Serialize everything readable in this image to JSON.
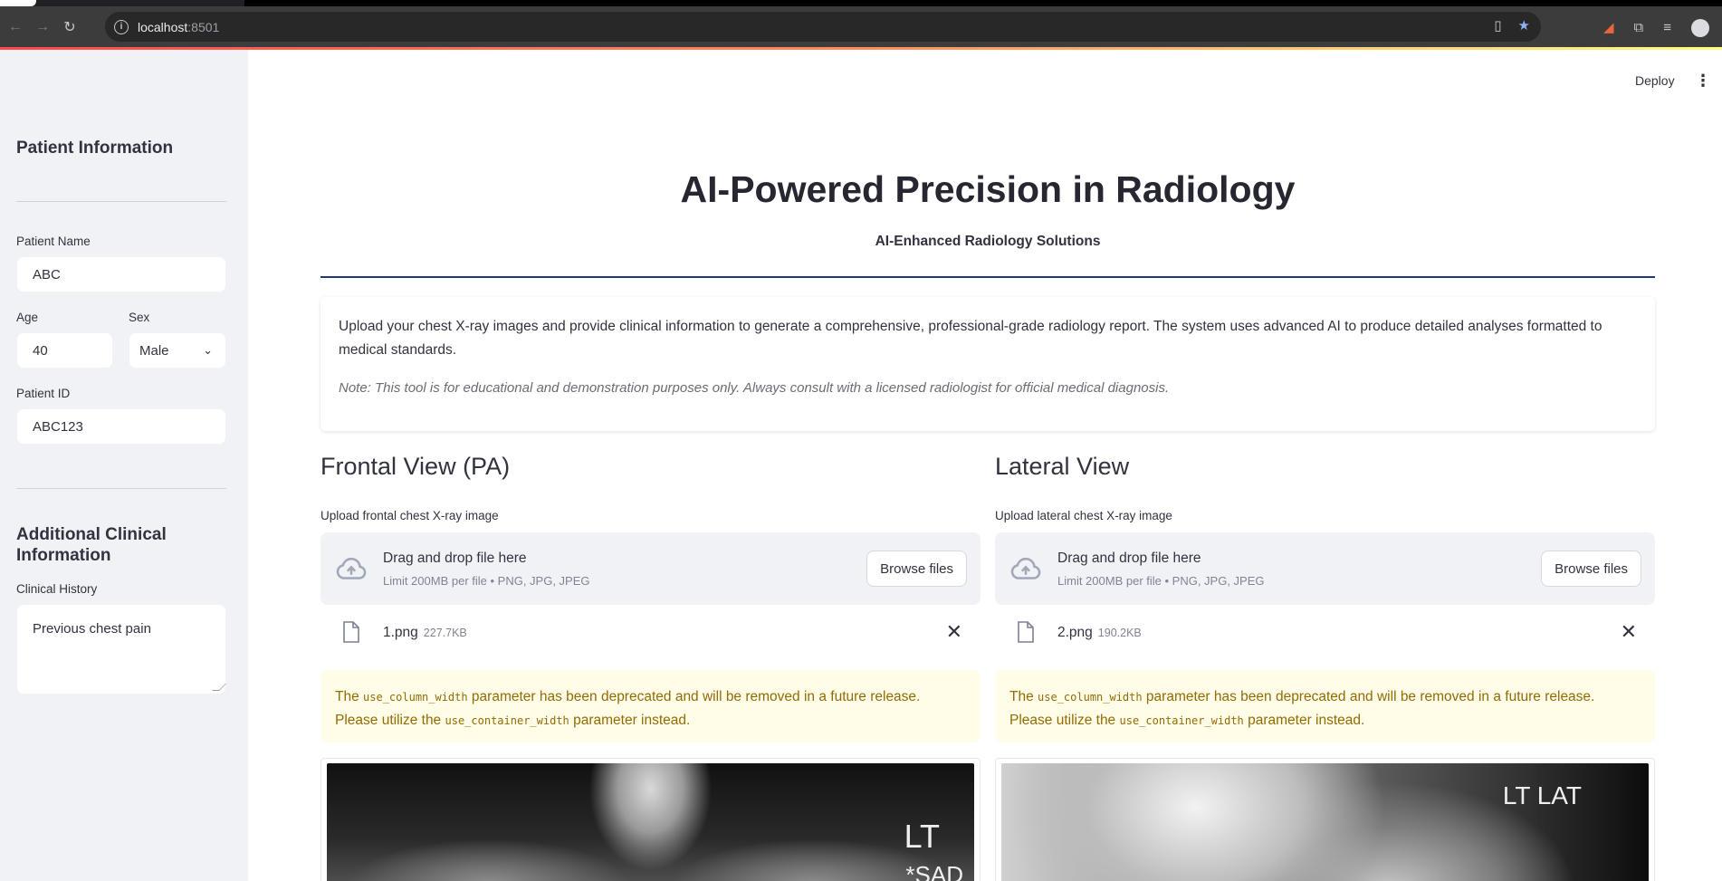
{
  "browser": {
    "url_host": "localhost",
    "url_port": ":8501"
  },
  "header": {
    "deploy_label": "Deploy"
  },
  "sidebar": {
    "patient_info_heading": "Patient Information",
    "patient_name_label": "Patient Name",
    "patient_name_value": "ABC",
    "age_label": "Age",
    "age_value": "40",
    "sex_label": "Sex",
    "sex_value": "Male",
    "patient_id_label": "Patient ID",
    "patient_id_value": "ABC123",
    "clinical_heading": "Additional Clinical Information",
    "clinical_history_label": "Clinical History",
    "clinical_history_value": "Previous chest pain"
  },
  "main": {
    "title": "AI-Powered Precision in Radiology",
    "subtitle": "AI-Enhanced Radiology Solutions",
    "intro": "Upload your chest X-ray images and provide clinical information to generate a comprehensive, professional-grade radiology report. The system uses advanced AI to produce detailed analyses formatted to medical standards.",
    "note": "Note: This tool is for educational and demonstration purposes only. Always consult with a licensed radiologist for official medical diagnosis."
  },
  "columns": [
    {
      "heading": "Frontal View (PA)",
      "upload_label": "Upload frontal chest X-ray image",
      "drop_title": "Drag and drop file here",
      "drop_limit": "Limit 200MB per file • PNG, JPG, JPEG",
      "browse_label": "Browse files",
      "file_name": "1.png",
      "file_size": "227.7KB",
      "warn_pre": "The ",
      "warn_code1": "use_column_width",
      "warn_mid": " parameter has been deprecated and will be removed in a future release. Please utilize the ",
      "warn_code2": "use_container_width",
      "warn_post": " parameter instead.",
      "image_label_1": "LT",
      "image_label_2": "*SAD"
    },
    {
      "heading": "Lateral View",
      "upload_label": "Upload lateral chest X-ray image",
      "drop_title": "Drag and drop file here",
      "drop_limit": "Limit 200MB per file • PNG, JPG, JPEG",
      "browse_label": "Browse files",
      "file_name": "2.png",
      "file_size": "190.2KB",
      "warn_pre": "The ",
      "warn_code1": "use_column_width",
      "warn_mid": " parameter has been deprecated and will be removed in a future release. Please utilize the ",
      "warn_code2": "use_container_width",
      "warn_post": " parameter instead.",
      "image_label_1": "LT LAT"
    }
  ],
  "colors": {
    "sidebar_bg": "#f0f2f6",
    "accent_rule": "#1e3a6e",
    "warning_bg": "#fffce7",
    "warning_text": "#926c05"
  }
}
